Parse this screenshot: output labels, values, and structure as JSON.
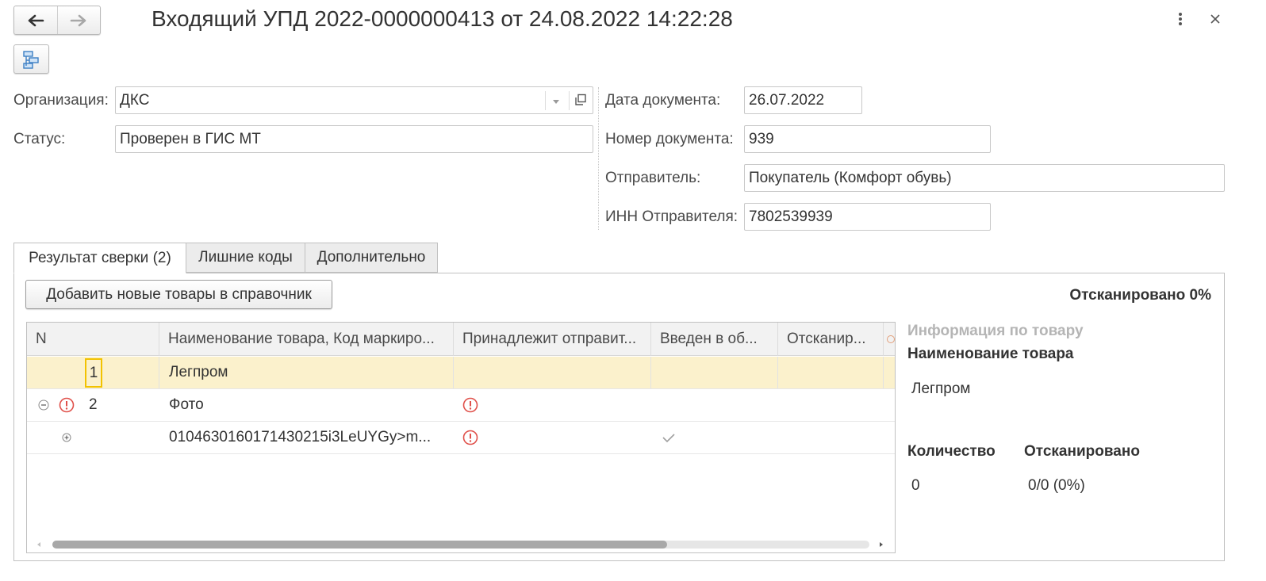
{
  "window": {
    "title": "Входящий УПД 2022-0000000413 от 24.08.2022 14:22:28",
    "icons": [
      "arrow-left-icon",
      "arrow-right-icon",
      "more-vertical-icon",
      "close-icon",
      "structure-icon"
    ]
  },
  "form": {
    "org_label": "Организация:",
    "org_value": "ДКС",
    "status_label": "Статус:",
    "status_value": "Проверен в ГИС МТ",
    "doc_date_label": "Дата документа:",
    "doc_date_value": "26.07.2022",
    "doc_number_label": "Номер документа:",
    "doc_number_value": "939",
    "sender_label": "Отправитель:",
    "sender_value": "Покупатель (Комфорт обувь)",
    "sender_inn_label": "ИНН Отправителя:",
    "sender_inn_value": "7802539939"
  },
  "tabs": [
    {
      "label": "Результат сверки (2)"
    },
    {
      "label": "Лишние коды"
    },
    {
      "label": "Дополнительно"
    }
  ],
  "toolbar": {
    "add_button": "Добавить новые товары в справочник",
    "scanned": "Отсканировано 0%"
  },
  "table": {
    "columns": [
      "N",
      "Наименование товара, Код маркиро...",
      "Принадлежит отправит...",
      "Введен в об...",
      "Отсканир..."
    ],
    "rows": [
      {
        "n": "1",
        "name": "Легпром",
        "selected": true
      },
      {
        "n": "2",
        "name": "Фото",
        "error": true
      },
      {
        "n": "",
        "name": "0104630160171430215i3LeUYGy>m..."
      }
    ]
  },
  "info": {
    "header": "Информация по товару",
    "name_label": "Наименование товара",
    "name_value": "Легпром",
    "qty_label": "Количество",
    "qty_value": "0",
    "scanned_label": "Отсканировано",
    "scanned_value": "0/0 (0%)"
  },
  "colors": {
    "selected_row": "#fbf1cc",
    "error": "#e0504a",
    "focus_border": "#f2c200"
  }
}
